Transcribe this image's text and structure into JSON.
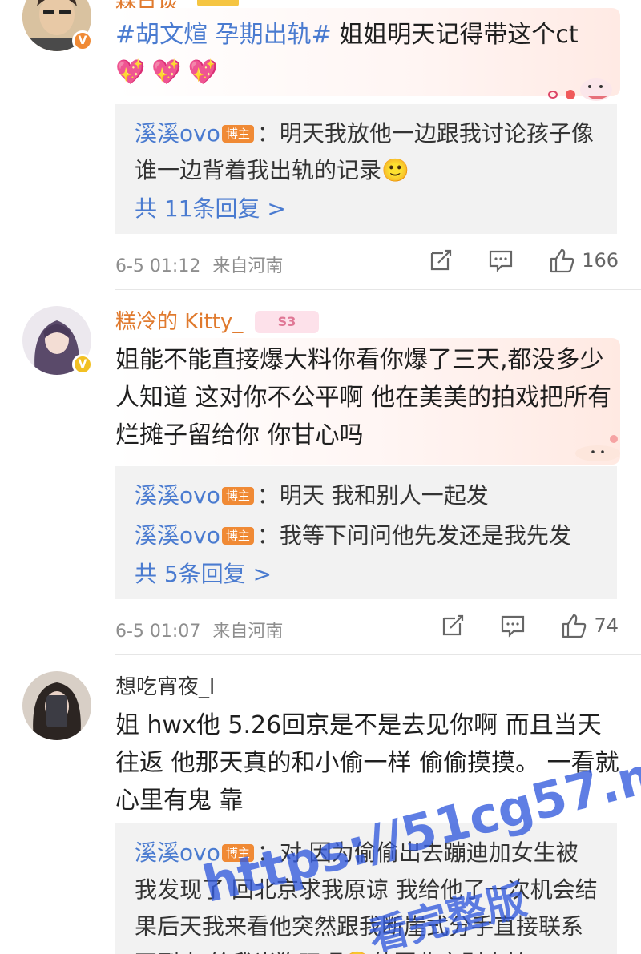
{
  "comments": [
    {
      "username": "森日谈",
      "topic": "#胡文煊 孕期出轨#",
      "text": " 姐姐明天记得带这个ct",
      "emoji": "💖💖💖",
      "replies": [
        {
          "name": "溪溪ovo",
          "badge": "博主",
          "text": "：明天我放他一边跟我讨论孩子像谁一边背着我出轨的记录🙂"
        }
      ],
      "more": "共 11条回复 >",
      "time": "6-5 01:12",
      "location": "来自河南",
      "likes": "166"
    },
    {
      "username": "糕冷的 Kitty_",
      "level_badge": "S3",
      "text": "姐能不能直接爆大料你看你爆了三天,都没多少人知道 这对你不公平啊 他在美美的拍戏把所有烂摊子留给你 你甘心吗",
      "replies": [
        {
          "name": "溪溪ovo",
          "badge": "博主",
          "text": "：明天 我和别人一起发"
        },
        {
          "name": "溪溪ovo",
          "badge": "博主",
          "text": "：我等下问问他先发还是我先发"
        }
      ],
      "more": "共 5条回复 >",
      "time": "6-5 01:07",
      "location": "来自河南",
      "likes": "74"
    },
    {
      "username": "想吃宵夜_l",
      "text": "姐 hwx他 5.26回京是不是去见你啊 而且当天往返  他那天真的和小偷一样 偷偷摸摸。 一看就心里有鬼 靠",
      "replies": [
        {
          "name": "溪溪ovo",
          "badge": "博主",
          "text": "：对 因为偷偷出去蹦迪加女生被我发现了 回北京求我原谅 我给他了一次机会结果后天我来看他突然跟我断崖式分手直接联系不到人 给我当狗玩呢🙂他回北京别人拍"
        }
      ]
    }
  ],
  "watermark": {
    "line1": "https://51cg57.me",
    "line2": "看完整版"
  },
  "colors": {
    "link_blue": "#4a7bd0",
    "badge_orange": "#f08a35",
    "username_orange": "#e07a2e",
    "reply_bg": "#f2f2f2"
  }
}
